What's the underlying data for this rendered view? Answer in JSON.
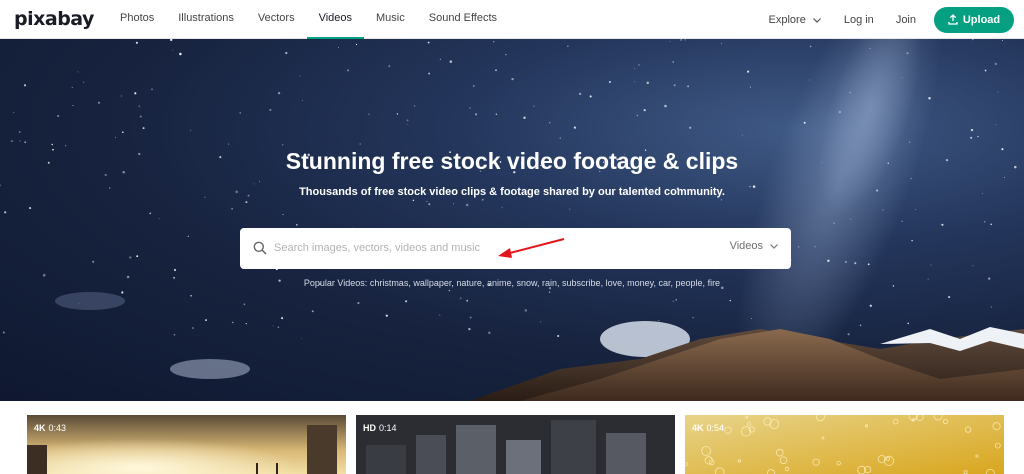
{
  "header": {
    "logo": "pixabay",
    "nav": [
      "Photos",
      "Illustrations",
      "Vectors",
      "Videos",
      "Music",
      "Sound Effects"
    ],
    "active_nav": "Videos",
    "explore": "Explore",
    "login": "Log in",
    "join": "Join",
    "upload": "Upload",
    "accent_color": "#05a081"
  },
  "hero": {
    "title": "Stunning free stock video footage & clips",
    "subtitle": "Thousands of free stock video clips & footage shared by our talented community.",
    "search": {
      "placeholder": "Search images, vectors, videos and music",
      "value": "",
      "type": "Videos",
      "icon": "search-icon"
    },
    "popular_label": "Popular Videos:",
    "popular_tags": [
      "christmas",
      "wallpaper",
      "nature",
      "anime",
      "snow",
      "rain",
      "subscribe",
      "love",
      "money",
      "car",
      "people",
      "fire"
    ]
  },
  "videos": [
    {
      "quality": "4K",
      "duration": "0:43"
    },
    {
      "quality": "HD",
      "duration": "0:14"
    },
    {
      "quality": "4K",
      "duration": "0:54"
    }
  ]
}
